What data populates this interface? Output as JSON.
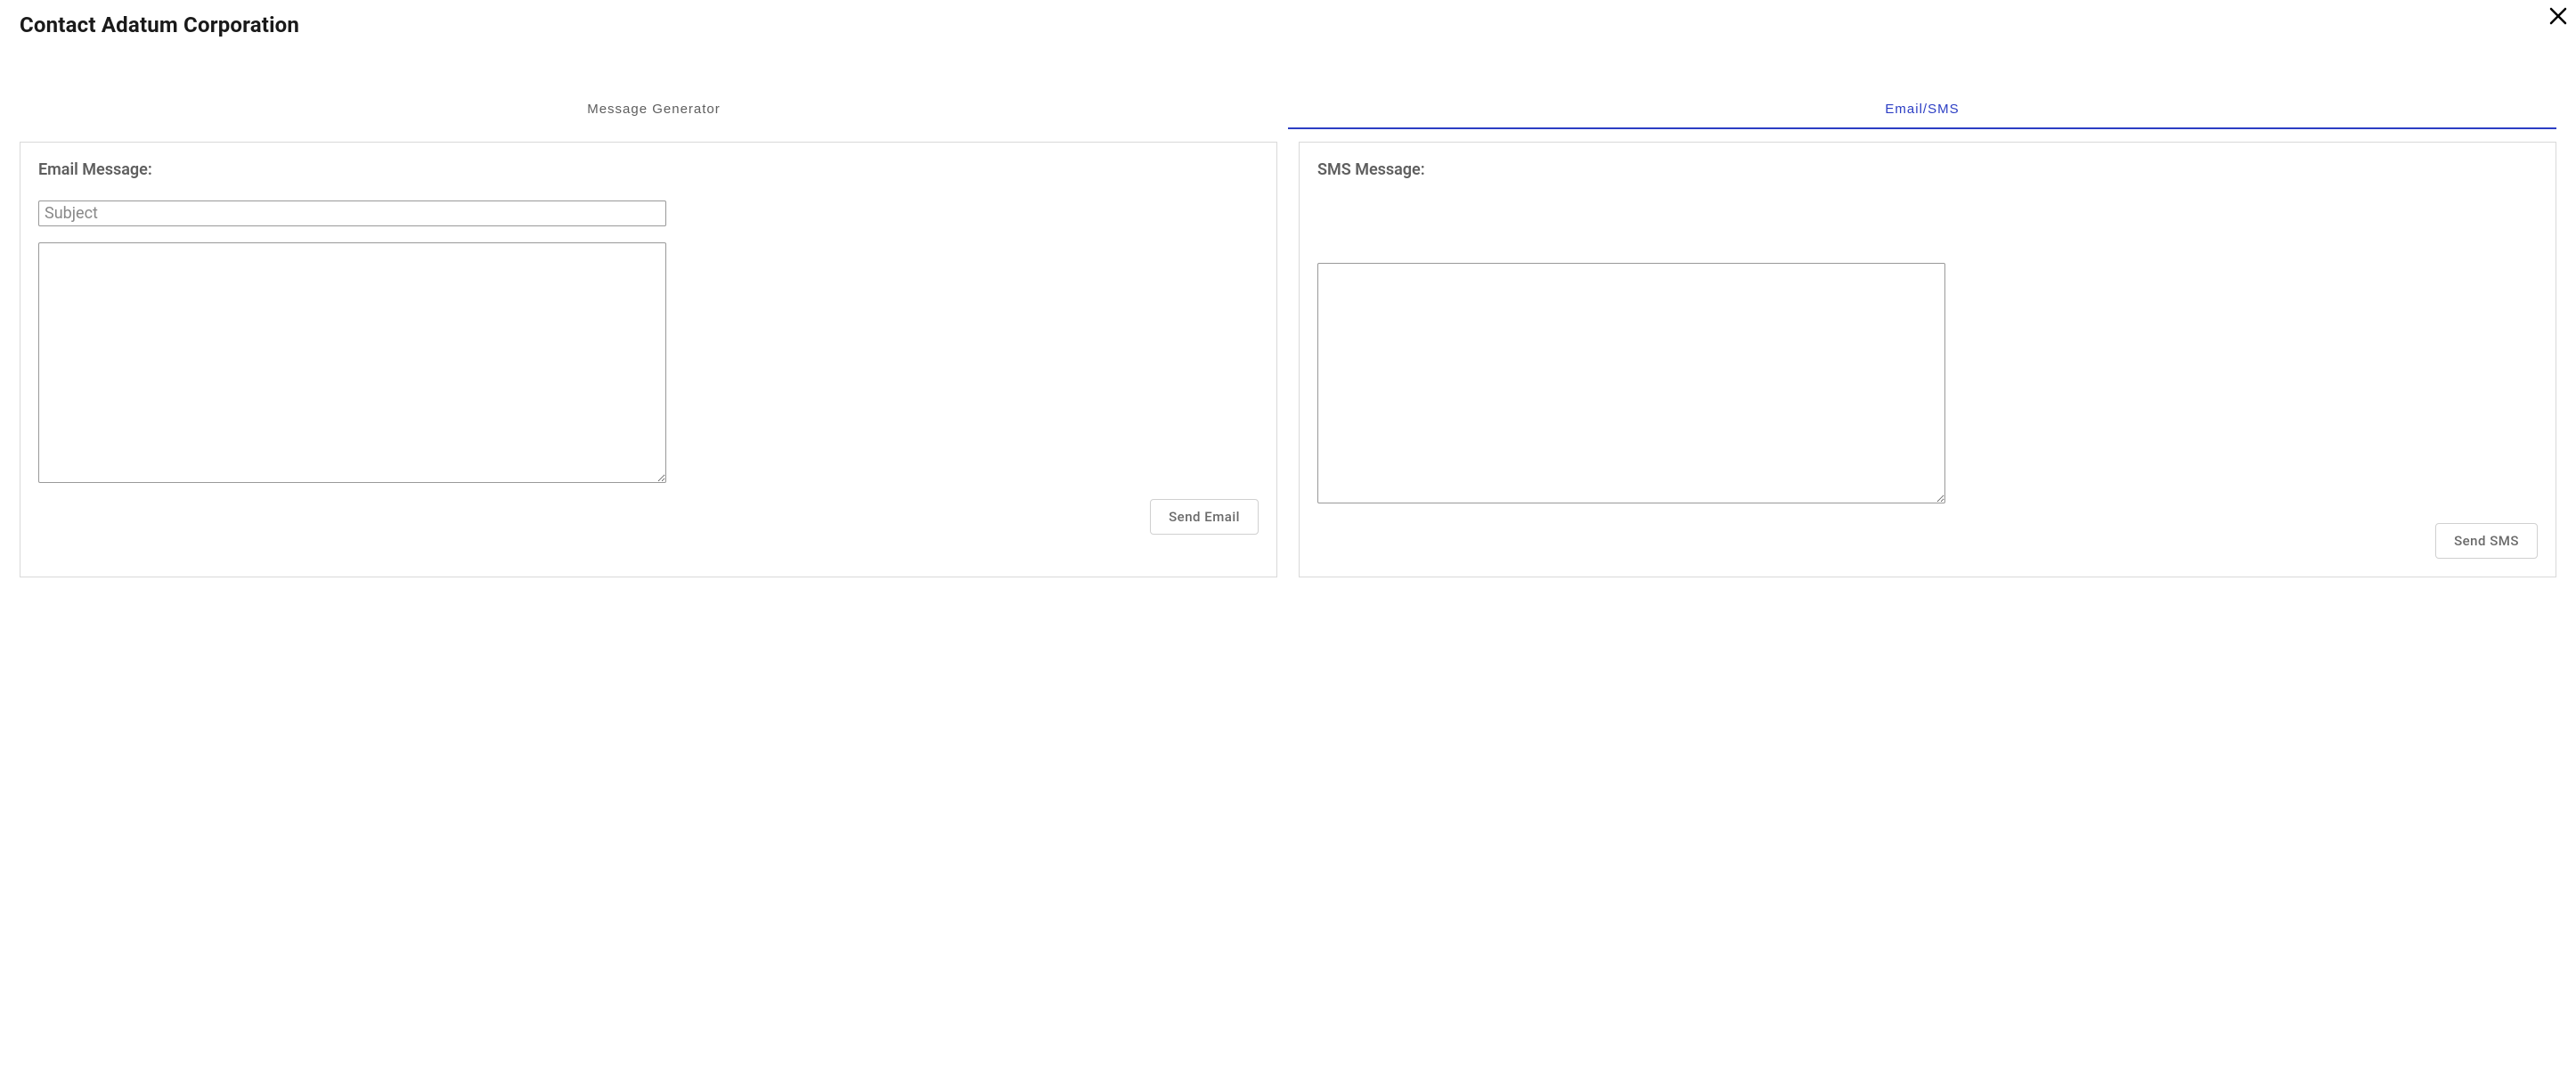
{
  "header": {
    "title": "Contact Adatum Corporation"
  },
  "tabs": {
    "message_generator": "Message Generator",
    "email_sms": "Email/SMS"
  },
  "email_panel": {
    "title": "Email Message:",
    "subject_placeholder": "Subject",
    "send_button": "Send Email"
  },
  "sms_panel": {
    "title": "SMS Message:",
    "send_button": "Send SMS"
  }
}
